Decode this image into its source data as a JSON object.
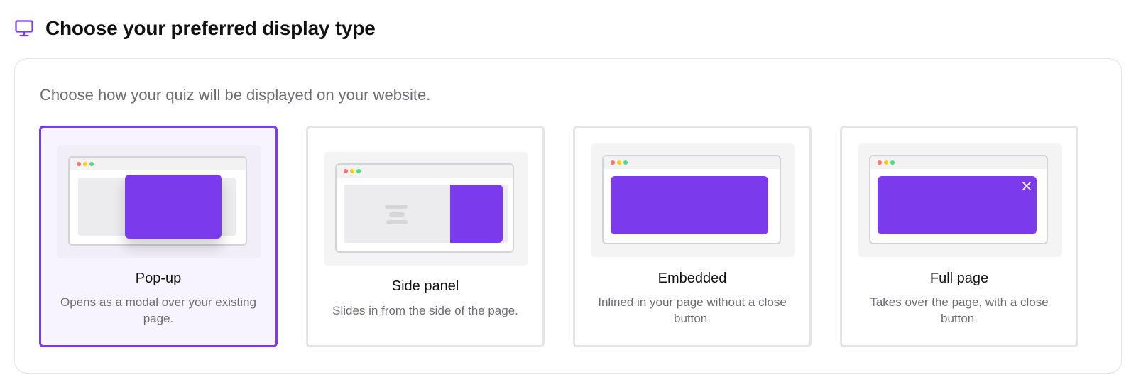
{
  "header": {
    "icon": "monitor-icon",
    "title": "Choose your preferred display type"
  },
  "panel": {
    "description": "Choose how your quiz will be displayed on your website."
  },
  "options": [
    {
      "id": "popup",
      "title": "Pop-up",
      "subtitle": "Opens as a modal over your existing page.",
      "selected": true
    },
    {
      "id": "side-panel",
      "title": "Side panel",
      "subtitle": "Slides in from the side of the page.",
      "selected": false
    },
    {
      "id": "embedded",
      "title": "Embedded",
      "subtitle": "Inlined in your page without a close button.",
      "selected": false
    },
    {
      "id": "full-page",
      "title": "Full page",
      "subtitle": "Takes over the page, with a close button.",
      "selected": false
    }
  ],
  "colors": {
    "accent": "#7c3aed",
    "selected_bg": "#f7f4fd",
    "card_border": "#e5e5e5",
    "muted_text": "#6b6b72"
  }
}
